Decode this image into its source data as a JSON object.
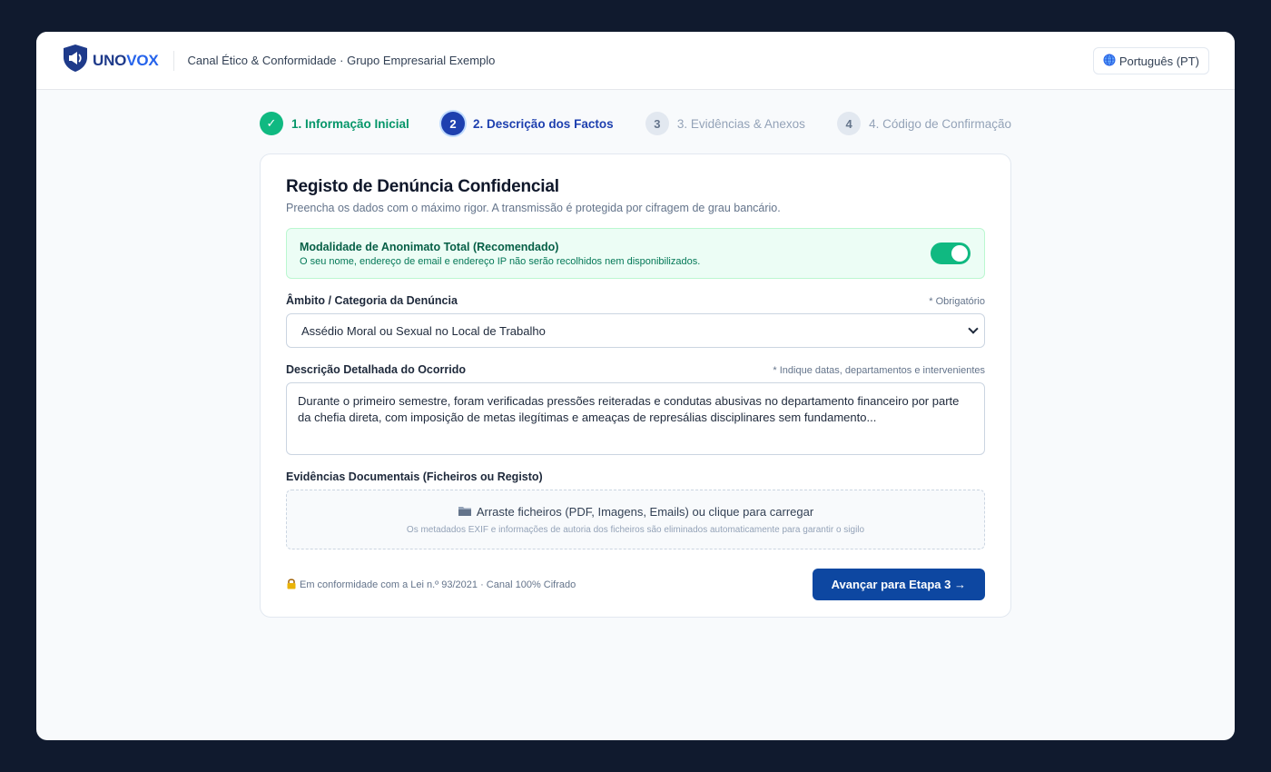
{
  "header": {
    "logo_text_a": "UNO",
    "logo_text_b": "VOX",
    "org_title": "Canal Ético & Conformidade · Grupo Empresarial Exemplo",
    "language_label": "Português (PT)"
  },
  "stepper": {
    "steps": [
      {
        "number": "✓",
        "label": "1. Informação Inicial",
        "state": "done"
      },
      {
        "number": "2",
        "label": "2. Descrição dos Factos",
        "state": "active"
      },
      {
        "number": "3",
        "label": "3. Evidências & Anexos",
        "state": "todo"
      },
      {
        "number": "4",
        "label": "4. Código de Confirmação",
        "state": "todo"
      }
    ]
  },
  "form": {
    "title": "Registo de Denúncia Confidencial",
    "subtitle": "Preencha os dados com o máximo rigor. A transmissão é protegida por cifragem de grau bancário.",
    "anonymity": {
      "title": "Modalidade de Anonimato Total (Recomendado)",
      "description": "O seu nome, endereço de email e endereço IP não serão recolhidos nem disponibilizados.",
      "enabled": true
    },
    "category": {
      "label": "Âmbito / Categoria da Denúncia",
      "hint": "* Obrigatório",
      "value": "Assédio Moral ou Sexual no Local de Trabalho"
    },
    "description": {
      "label": "Descrição Detalhada do Ocorrido",
      "hint": "* Indique datas, departamentos e intervenientes",
      "value": "Durante o primeiro semestre, foram verificadas pressões reiteradas e condutas abusivas no departamento financeiro por parte da chefia direta, com imposição de metas ilegítimas e ameaças de represálias disciplinares sem fundamento..."
    },
    "evidence": {
      "label": "Evidências Documentais (Ficheiros ou Registo)",
      "drop_text": "Arraste ficheiros (PDF, Imagens, Emails) ou clique para carregar",
      "drop_subtext": "Os metadados EXIF e informações de autoria dos ficheiros são eliminados automaticamente para garantir o sigilo"
    },
    "compliance_text": "Em conformidade com a Lei n.º 93/2021 · Canal 100% Cifrado",
    "next_button": "Avançar para Etapa 3 →"
  },
  "colors": {
    "brand": "#1e40af",
    "success": "#10b981",
    "primary_button": "#0d47a1"
  },
  "icons": [
    "shield-megaphone-logo-icon",
    "globe-icon",
    "check-icon",
    "folder-icon",
    "lock-icon",
    "chevron-down-icon"
  ]
}
